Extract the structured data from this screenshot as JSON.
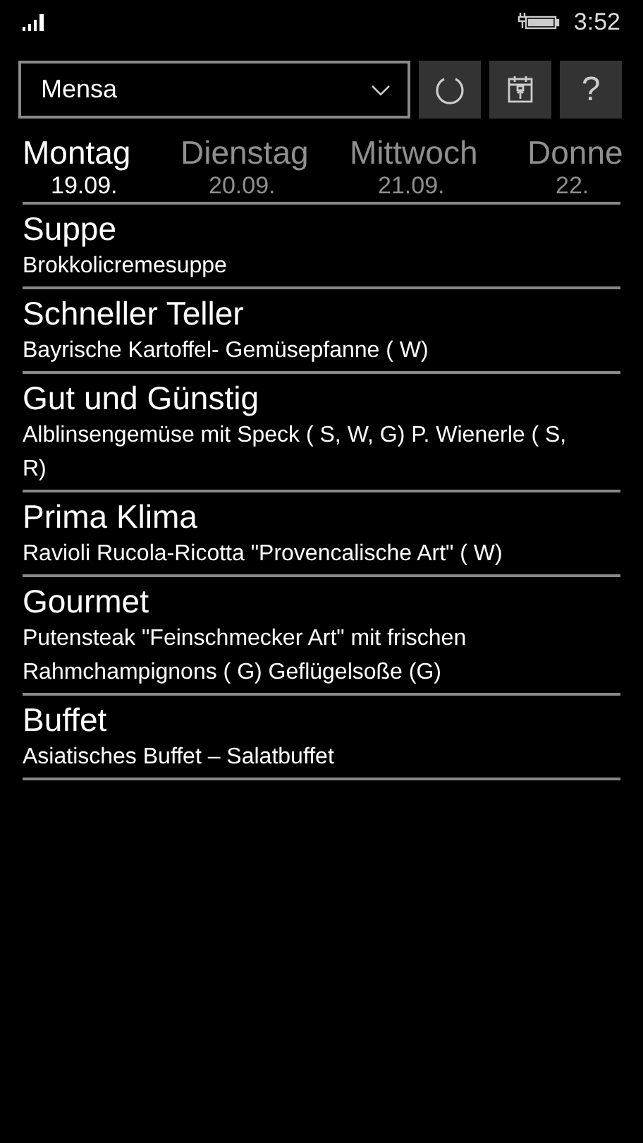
{
  "status_bar": {
    "time": "3:52"
  },
  "toolbar": {
    "dropdown": {
      "value": "Mensa"
    },
    "buttons": [
      {
        "kind": "refresh"
      },
      {
        "kind": "calendar"
      },
      {
        "kind": "help",
        "label": "?"
      }
    ]
  },
  "days": [
    {
      "name": "Montag",
      "date": "19.09.",
      "selected": true
    },
    {
      "name": "Dienstag",
      "date": "20.09.",
      "selected": false
    },
    {
      "name": "Mittwoch",
      "date": "21.09.",
      "selected": false
    },
    {
      "name": "Donne",
      "date": "22.",
      "selected": false
    }
  ],
  "menu": [
    {
      "title": "Suppe",
      "dish": "Brokkolicremesuppe"
    },
    {
      "title": "Schneller Teller",
      "dish": "Bayrische Kartoffel- Gemüsepfanne ( W)"
    },
    {
      "title": "Gut und Günstig",
      "dish": "Alblinsengemüse mit Speck ( S, W, G) P. Wienerle ( S, R)"
    },
    {
      "title": "Prima Klima",
      "dish": "Ravioli Rucola-Ricotta \"Provencalische Art\" ( W)"
    },
    {
      "title": "Gourmet",
      "dish": "Putensteak \"Feinschmecker Art\" mit frischen Rahmchampignons ( G) Geflügelsoße (G)"
    },
    {
      "title": "Buffet",
      "dish": "Asiatisches Buffet – Salatbuffet"
    }
  ]
}
